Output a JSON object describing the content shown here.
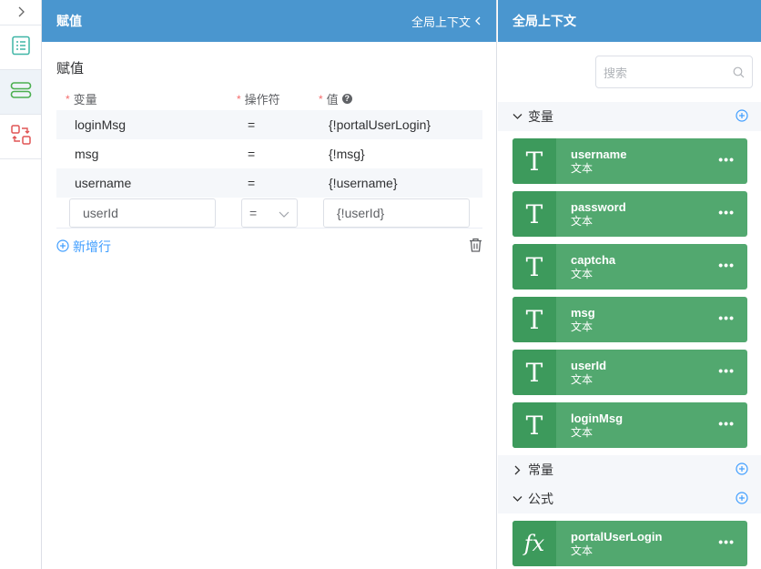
{
  "center": {
    "header_title": "赋值",
    "global_context_label": "全局上下文",
    "section_title": "赋值",
    "col_variable": "变量",
    "col_operator": "操作符",
    "col_value": "值",
    "required_mark": "*",
    "help_glyph": "?",
    "rows": [
      {
        "variable": "loginMsg",
        "operator": "=",
        "value": "{!portalUserLogin}"
      },
      {
        "variable": "msg",
        "operator": "=",
        "value": "{!msg}"
      },
      {
        "variable": "username",
        "operator": "=",
        "value": "{!username}"
      }
    ],
    "edit_row": {
      "variable": "userId",
      "operator": "=",
      "value": "{!userId}"
    },
    "add_row_label": "新增行"
  },
  "right": {
    "header_title": "全局上下文",
    "search_placeholder": "搜索",
    "groups": [
      {
        "label": "变量",
        "expanded": true
      },
      {
        "label": "常量",
        "expanded": false
      },
      {
        "label": "公式",
        "expanded": true
      }
    ],
    "variables": [
      {
        "name": "username",
        "type": "文本",
        "icon": "T"
      },
      {
        "name": "password",
        "type": "文本",
        "icon": "T"
      },
      {
        "name": "captcha",
        "type": "文本",
        "icon": "T"
      },
      {
        "name": "msg",
        "type": "文本",
        "icon": "T"
      },
      {
        "name": "userId",
        "type": "文本",
        "icon": "T"
      },
      {
        "name": "loginMsg",
        "type": "文本",
        "icon": "T"
      }
    ],
    "formulas": [
      {
        "name": "portalUserLogin",
        "type": "文本",
        "icon": "fx"
      }
    ],
    "more_glyph": "•••"
  },
  "colors": {
    "header_blue": "#4a96cf",
    "card_green": "#52a86f",
    "card_icon_green": "#3d9a5c",
    "link_blue": "#409eff",
    "required_red": "#f56c6c"
  },
  "icons": {
    "rail_toggle": "chevron-right-icon",
    "rail_1": "list-doc-icon",
    "rail_2": "assignment-icon",
    "rail_3": "swap-icon"
  }
}
